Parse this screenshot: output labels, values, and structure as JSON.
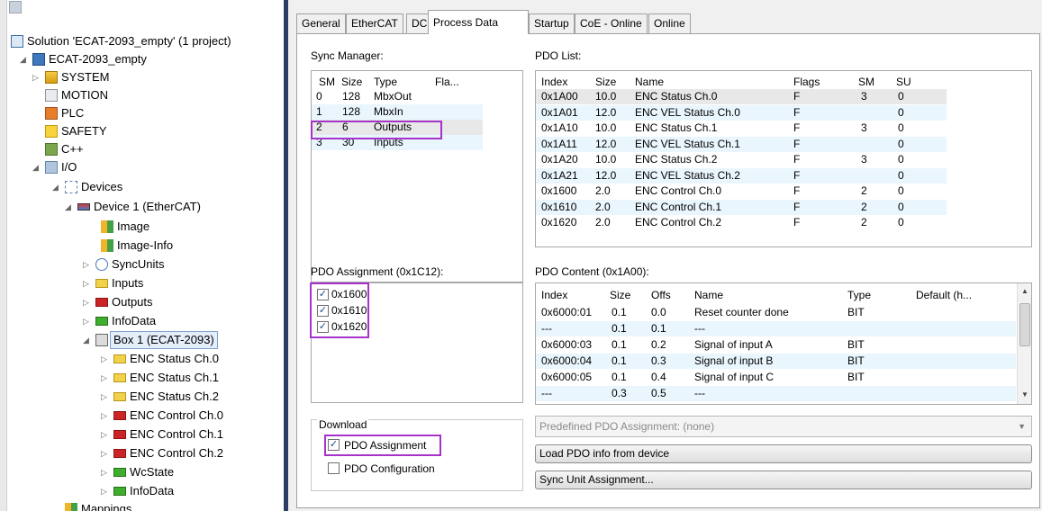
{
  "tree": {
    "solution": "Solution 'ECAT-2093_empty' (1 project)",
    "project": "ECAT-2093_empty",
    "nodes": [
      {
        "label": "SYSTEM"
      },
      {
        "label": "MOTION"
      },
      {
        "label": "PLC"
      },
      {
        "label": "SAFETY"
      },
      {
        "label": "C++"
      },
      {
        "label": "I/O"
      },
      {
        "label": "Devices"
      },
      {
        "label": "Device 1 (EtherCAT)"
      },
      {
        "label": "Image"
      },
      {
        "label": "Image-Info"
      },
      {
        "label": "SyncUnits"
      },
      {
        "label": "Inputs"
      },
      {
        "label": "Outputs"
      },
      {
        "label": "InfoData"
      },
      {
        "label": "Box 1 (ECAT-2093)"
      },
      {
        "label": "ENC Status Ch.0"
      },
      {
        "label": "ENC Status Ch.1"
      },
      {
        "label": "ENC Status Ch.2"
      },
      {
        "label": "ENC Control Ch.0"
      },
      {
        "label": "ENC Control Ch.1"
      },
      {
        "label": "ENC Control Ch.2"
      },
      {
        "label": "WcState"
      },
      {
        "label": "InfoData"
      },
      {
        "label": "Mappings"
      }
    ]
  },
  "tabs": [
    "General",
    "EtherCAT",
    "DC",
    "Process Data",
    "Startup",
    "CoE - Online",
    "Online"
  ],
  "sync_manager": {
    "label": "Sync Manager:",
    "headers": [
      "SM",
      "Size",
      "Type",
      "Fla..."
    ],
    "rows": [
      [
        "0",
        "128",
        "MbxOut",
        ""
      ],
      [
        "1",
        "128",
        "MbxIn",
        ""
      ],
      [
        "2",
        "6",
        "Outputs",
        ""
      ],
      [
        "3",
        "30",
        "Inputs",
        ""
      ]
    ]
  },
  "pdo_list": {
    "label": "PDO List:",
    "headers": [
      "Index",
      "Size",
      "Name",
      "Flags",
      "SM",
      "SU"
    ],
    "rows": [
      [
        "0x1A00",
        "10.0",
        "ENC Status Ch.0",
        "F",
        "3",
        "0"
      ],
      [
        "0x1A01",
        "12.0",
        "ENC VEL Status Ch.0",
        "F",
        "",
        "0"
      ],
      [
        "0x1A10",
        "10.0",
        "ENC Status Ch.1",
        "F",
        "3",
        "0"
      ],
      [
        "0x1A11",
        "12.0",
        "ENC VEL Status Ch.1",
        "F",
        "",
        "0"
      ],
      [
        "0x1A20",
        "10.0",
        "ENC Status Ch.2",
        "F",
        "3",
        "0"
      ],
      [
        "0x1A21",
        "12.0",
        "ENC VEL Status Ch.2",
        "F",
        "",
        "0"
      ],
      [
        "0x1600",
        "2.0",
        "ENC Control Ch.0",
        "F",
        "2",
        "0"
      ],
      [
        "0x1610",
        "2.0",
        "ENC Control Ch.1",
        "F",
        "2",
        "0"
      ],
      [
        "0x1620",
        "2.0",
        "ENC Control Ch.2",
        "F",
        "2",
        "0"
      ]
    ]
  },
  "pdo_assignment": {
    "label": "PDO Assignment (0x1C12):",
    "items": [
      {
        "label": "0x1600",
        "checked": true
      },
      {
        "label": "0x1610",
        "checked": true
      },
      {
        "label": "0x1620",
        "checked": true
      }
    ]
  },
  "pdo_content": {
    "label": "PDO Content (0x1A00):",
    "headers": [
      "Index",
      "Size",
      "Offs",
      "Name",
      "Type",
      "Default (h..."
    ],
    "rows": [
      [
        "0x6000:01",
        "0.1",
        "0.0",
        "Reset counter done",
        "BIT",
        ""
      ],
      [
        "---",
        "0.1",
        "0.1",
        "---",
        "",
        ""
      ],
      [
        "0x6000:03",
        "0.1",
        "0.2",
        "Signal of input A",
        "BIT",
        ""
      ],
      [
        "0x6000:04",
        "0.1",
        "0.3",
        "Signal of input B",
        "BIT",
        ""
      ],
      [
        "0x6000:05",
        "0.1",
        "0.4",
        "Signal of input C",
        "BIT",
        ""
      ],
      [
        "---",
        "0.3",
        "0.5",
        "---",
        "",
        ""
      ]
    ]
  },
  "download": {
    "label": "Download",
    "pdo_assignment": {
      "label": "PDO Assignment",
      "checked": true
    },
    "pdo_configuration": {
      "label": "PDO Configuration",
      "checked": false
    }
  },
  "predefined": "Predefined PDO Assignment: (none)",
  "buttons": {
    "load_pdo": "Load PDO info from device",
    "sync_unit": "Sync Unit Assignment..."
  },
  "glyphs": {
    "check": "✓",
    "expand": "▷",
    "collapse": "◢",
    "dropdown": "▼",
    "scroll_up": "▲",
    "scroll_down": "▼"
  },
  "colors": {
    "highlight": "#a633c9",
    "alt_row": "#eaf6fd",
    "divider": "#2b3d64"
  }
}
